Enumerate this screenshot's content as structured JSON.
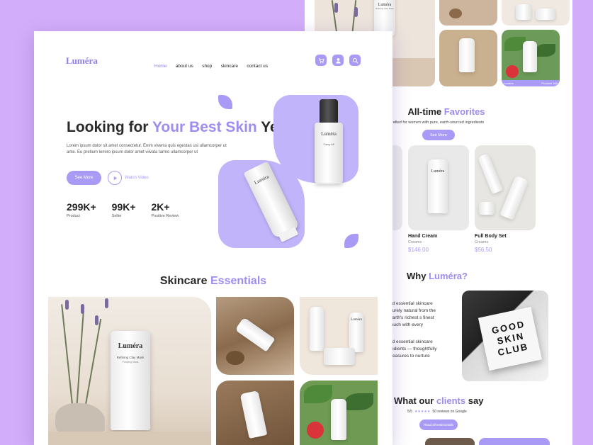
{
  "brand": "Luméra",
  "nav": {
    "home": "Home",
    "about": "about us",
    "shop": "shop",
    "skincare": "skincare",
    "contact": "contact us"
  },
  "hero": {
    "title_a": "Looking for ",
    "title_b": "Your Best Skin",
    "title_c": " Yet?",
    "desc": "Lorem ipsum dolor sit amet consectetur. Enim viverra quis egestas usi ullamcorper ut ante. Eu pretium lemiro ipsum dolor amet viivata tarmo  ullamcorper ut",
    "see_more": "See More",
    "watch": "Watch Video",
    "stats": [
      {
        "n": "299K+",
        "l": "Product"
      },
      {
        "n": "99K+",
        "l": "Seller"
      },
      {
        "n": "2K+",
        "l": "Positive Review"
      }
    ],
    "product_label_1": "Luméra",
    "product_label_2": "Luméra",
    "product_small": "Carry All"
  },
  "essentials": {
    "title_a": "Skincare ",
    "title_b": "Essentials",
    "tube_brand": "Luméra",
    "tube_name": "Refining Clay Mask",
    "tube_sub": "Purifying Mask",
    "jar_brand": "Luméra"
  },
  "back": {
    "top_tube": "Luméra",
    "top_tube_name": "Refining Clay Mask",
    "gallery_bottom_a": "Luméra",
    "gallery_bottom_b": "Produce 185",
    "fav_title_a": "All-time ",
    "fav_title_b": "Favorites",
    "fav_sub": "crafted for women with pure, earth-sourced ingredients",
    "fav_btn": "See More",
    "products": [
      {
        "name": "Hand Cream",
        "sub": "Creams",
        "price": "$146.00"
      },
      {
        "name": "Full Body Set",
        "sub": "Creams",
        "price": "$56.50"
      }
    ],
    "why_a": "Why ",
    "why_b": "Luméra?",
    "why_p1": "nd essential skincare purely natural from the earth's richest s finest touch with every",
    "why_p2": "nd essential skincare redients — thoughtfully treasures to nurture",
    "club": "GOOD SKIN CLUB",
    "clients_a": "What our ",
    "clients_b": "clients",
    " clients_c": " say",
    "clients_c": " say",
    "rating": "5/5",
    "reviews": "50 reviews on Google",
    "reviews_btn": "Read all testimonials"
  },
  "colors": {
    "bg": "#d2aefa",
    "accent": "#9c8ef0",
    "button": "#a99bf5"
  },
  "icons": [
    "cart-icon",
    "user-icon",
    "search-icon",
    "play-icon",
    "star-icon"
  ]
}
